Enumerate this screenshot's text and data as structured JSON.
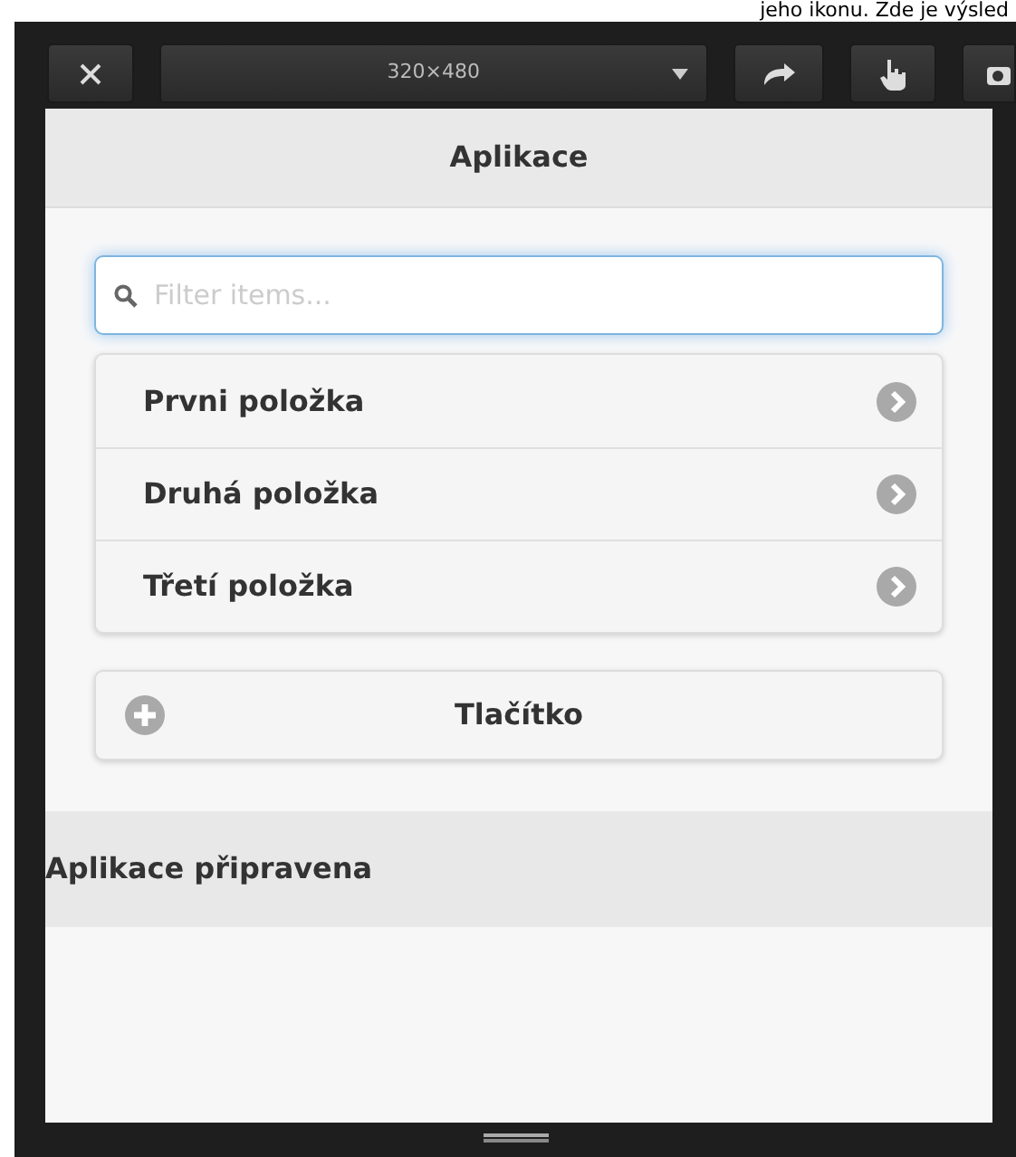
{
  "caption": "jeho ikonu. Zde je výsled",
  "toolbar": {
    "size": "320×480"
  },
  "header": {
    "title": "Aplikace"
  },
  "search": {
    "placeholder": "Filter items..."
  },
  "items": [
    {
      "label": "Prvni položka"
    },
    {
      "label": "Druhá položka"
    },
    {
      "label": "Třetí položka"
    }
  ],
  "button": {
    "label": "Tlačítko"
  },
  "footer": {
    "text": "Aplikace připravena"
  }
}
